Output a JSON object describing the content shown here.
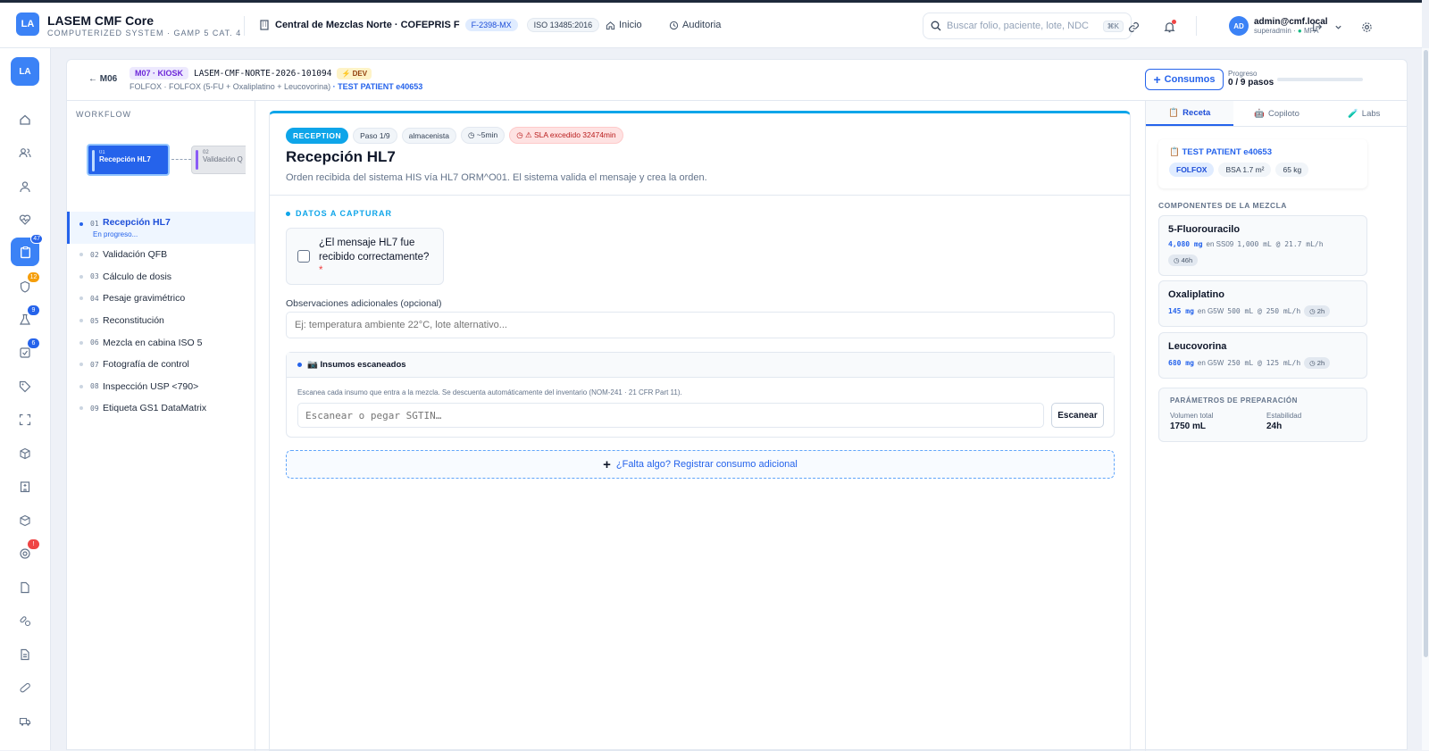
{
  "app": {
    "logo": "LA",
    "title": "LASEM CMF Core",
    "subtitle": "COMPUTERIZED SYSTEM · GAMP 5 CAT. 4"
  },
  "site": {
    "name": "Central de Mezclas Norte · COFEPRIS F",
    "license": "F-2398-MX",
    "iso": "ISO 13485:2016"
  },
  "nav": {
    "home": "Inicio",
    "audit": "Auditoria"
  },
  "search": {
    "placeholder": "Buscar folio, paciente, lote, NDC",
    "shortcut": "⌘K"
  },
  "user": {
    "initials": "AD",
    "email": "admin@cmf.local",
    "role": "superadmin ·",
    "mfa": "MFA"
  },
  "rail": {
    "logo": "LA",
    "badges": {
      "orders": "47",
      "shield": "12",
      "flask": "9",
      "check": "6",
      "alert": "!"
    }
  },
  "header": {
    "back": "← M06",
    "module": "M07 · KIOSK",
    "folio": "LASEM-CMF-NORTE-2026-101094",
    "env": "⚡ DEV",
    "protocol": "FOLFOX · FOLFOX (5-FU + Oxaliplatino + Leucovorina)",
    "patient": "· TEST PATIENT e40653",
    "consumos": "Consumos",
    "progress_label": "Progreso",
    "progress_value": "0 / 9 pasos",
    "progress_fraction": 0
  },
  "workflow": {
    "title": "WORKFLOW",
    "mini": [
      {
        "k": "01",
        "label": "Recepción HL7"
      },
      {
        "k": "02",
        "label": "Validación Q"
      }
    ],
    "active_sub": "En progreso...",
    "steps": [
      {
        "num": "01",
        "label": "Recepción HL7"
      },
      {
        "num": "02",
        "label": "Validación QFB"
      },
      {
        "num": "03",
        "label": "Cálculo de dosis"
      },
      {
        "num": "04",
        "label": "Pesaje gravimétrico"
      },
      {
        "num": "05",
        "label": "Reconstitución"
      },
      {
        "num": "06",
        "label": "Mezcla en cabina ISO 5"
      },
      {
        "num": "07",
        "label": "Fotografía de control"
      },
      {
        "num": "08",
        "label": "Inspección USP <790>"
      },
      {
        "num": "09",
        "label": "Etiqueta GS1 DataMatrix"
      }
    ]
  },
  "step": {
    "badge": "RECEPTION",
    "paso": "Paso 1/9",
    "role": "almacenista",
    "eta": "◷ ~5min",
    "sla": "◷ ⚠ SLA excedido 32474min",
    "title": "Recepción HL7",
    "desc": "Orden recibida del sistema HIS vía HL7 ORM^O01. El sistema valida el mensaje y crea la orden.",
    "section": "DATOS A CAPTURAR",
    "question": "¿El mensaje HL7 fue recibido correctamente?",
    "required": "*",
    "obs_label": "Observaciones adicionales (opcional)",
    "obs_placeholder": "Ej: temperatura ambiente 22°C, lote alternativo...",
    "scan_title": "📷 Insumos escaneados",
    "scan_desc": "Escanea cada insumo que entra a la mezcla. Se descuenta automáticamente del inventario (NOM-241 · 21 CFR Part 11).",
    "scan_placeholder": "Escanear o pegar SGTIN…",
    "scan_button": "Escanear",
    "add_consumo": "¿Falta algo? Registrar consumo adicional"
  },
  "right": {
    "tabs": [
      "Receta",
      "Copiloto",
      "Labs"
    ],
    "patient": "TEST PATIENT e40653",
    "chips": [
      "FOLFOX",
      "BSA 1.7 m²",
      "65 kg"
    ],
    "components_title": "COMPONENTES DE LA MEZCLA",
    "components": [
      {
        "name": "5-Fluorouracilo",
        "dose": "4,080 mg",
        "vehicle": "en SS09",
        "vol": "1,000 mL @ 21.7 mL/h",
        "time": "◷ 46h"
      },
      {
        "name": "Oxaliplatino",
        "dose": "145 mg",
        "vehicle": "en G5W",
        "vol": "500 mL @ 250 mL/h",
        "time": "◷ 2h"
      },
      {
        "name": "Leucovorina",
        "dose": "680 mg",
        "vehicle": "en G5W",
        "vol": "250 mL @ 125 mL/h",
        "time": "◷ 2h"
      }
    ],
    "params_title": "PARÁMETROS DE PREPARACIÓN",
    "params": [
      {
        "k": "Volumen total",
        "v": "1750 mL"
      },
      {
        "k": "Estabilidad",
        "v": "24h"
      }
    ]
  }
}
